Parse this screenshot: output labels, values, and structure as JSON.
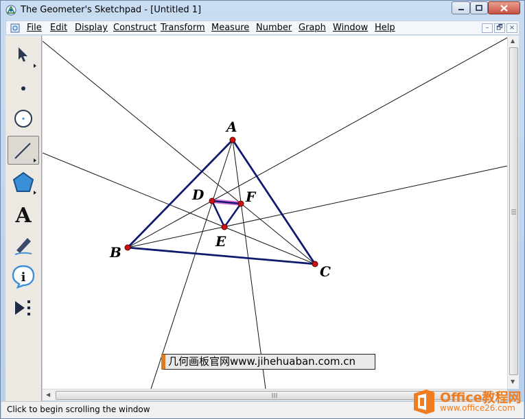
{
  "window": {
    "title": "The Geometer's Sketchpad - [Untitled 1]",
    "buttons": {
      "minimize_icon": "minimize-icon",
      "maximize_icon": "maximize-icon",
      "close_icon": "close-icon"
    }
  },
  "menubar": {
    "items": [
      {
        "label": "File"
      },
      {
        "label": "Edit"
      },
      {
        "label": "Display"
      },
      {
        "label": "Construct"
      },
      {
        "label": "Transform"
      },
      {
        "label": "Measure"
      },
      {
        "label": "Number"
      },
      {
        "label": "Graph"
      },
      {
        "label": "Window"
      },
      {
        "label": "Help"
      }
    ],
    "doc_buttons": {
      "minimize": "–",
      "restore": "🗗",
      "close": "×"
    }
  },
  "toolbox": {
    "tools": [
      {
        "name": "arrow-tool",
        "icon": "arrow-icon"
      },
      {
        "name": "point-tool",
        "icon": "point-icon"
      },
      {
        "name": "compass-tool",
        "icon": "compass-icon"
      },
      {
        "name": "straightedge-tool",
        "icon": "segment-icon",
        "active": true
      },
      {
        "name": "polygon-tool",
        "icon": "polygon-icon"
      },
      {
        "name": "text-tool",
        "icon": "text-icon",
        "label": "A"
      },
      {
        "name": "marker-tool",
        "icon": "marker-icon"
      },
      {
        "name": "information-tool",
        "icon": "information-icon",
        "label": "i"
      },
      {
        "name": "custom-tool",
        "icon": "custom-tool-icon"
      }
    ]
  },
  "sketch": {
    "points": {
      "A": {
        "label": "A"
      },
      "B": {
        "label": "B"
      },
      "C": {
        "label": "C"
      },
      "D": {
        "label": "D"
      },
      "E": {
        "label": "E"
      },
      "F": {
        "label": "F"
      }
    },
    "colors": {
      "triangle": "#0f1a6e",
      "point": "#cc1111",
      "line": "#000000",
      "selected_segment": "#d04bd0"
    }
  },
  "watermark": {
    "text": "几何画板官网www.jihehuaban.com.cn"
  },
  "status": {
    "text": "Click to begin scrolling the window"
  },
  "branding": {
    "name": "Office教程网",
    "url": "www.office26.com",
    "color": "#ef7d22"
  }
}
